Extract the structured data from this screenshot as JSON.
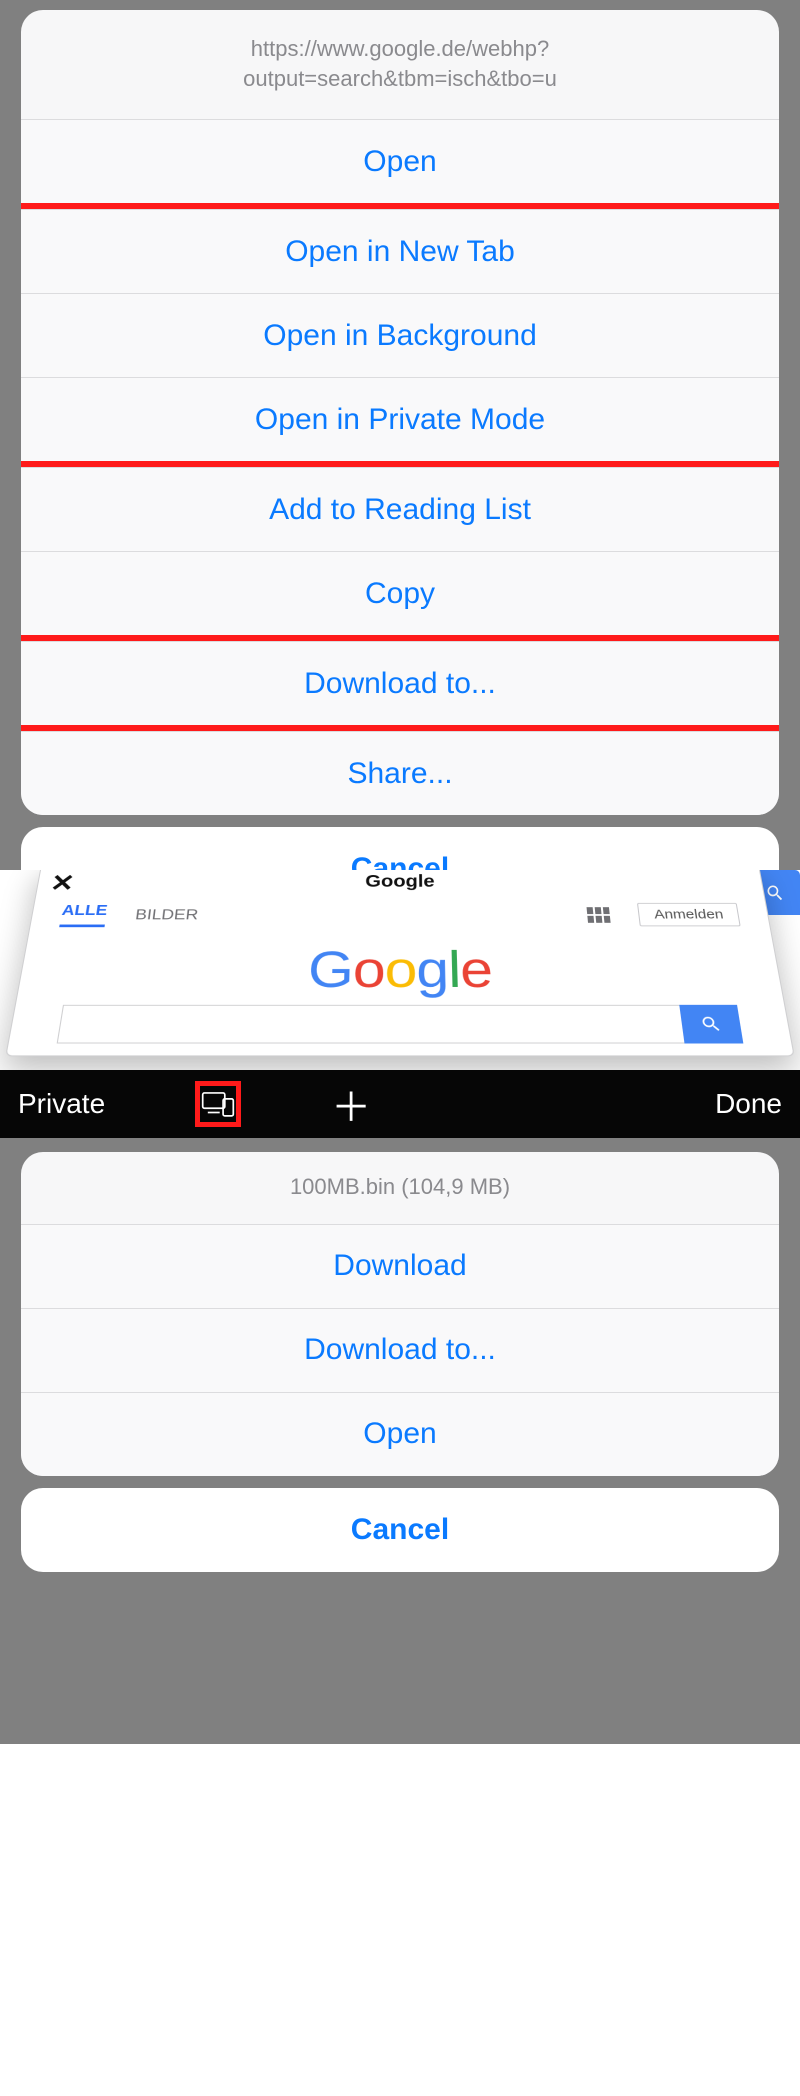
{
  "panel1": {
    "url_line1": "https://www.google.de/webhp?",
    "url_line2": "output=search&tbm=isch&tbo=u",
    "items": {
      "open": "Open",
      "open_new_tab": "Open in New Tab",
      "open_background": "Open in Background",
      "open_private": "Open in Private Mode",
      "reading_list": "Add to Reading List",
      "copy": "Copy",
      "download_to": "Download to...",
      "share": "Share..."
    },
    "cancel": "Cancel"
  },
  "panel2": {
    "card_title": "Google",
    "tab_all": "ALLE",
    "tab_images": "BILDER",
    "sign_in": "Anmelden",
    "toolbar": {
      "private": "Private",
      "done": "Done"
    }
  },
  "panel3": {
    "header": "100MB.bin (104,9 MB)",
    "items": {
      "download": "Download",
      "download_to": "Download to...",
      "open": "Open"
    },
    "cancel": "Cancel"
  }
}
